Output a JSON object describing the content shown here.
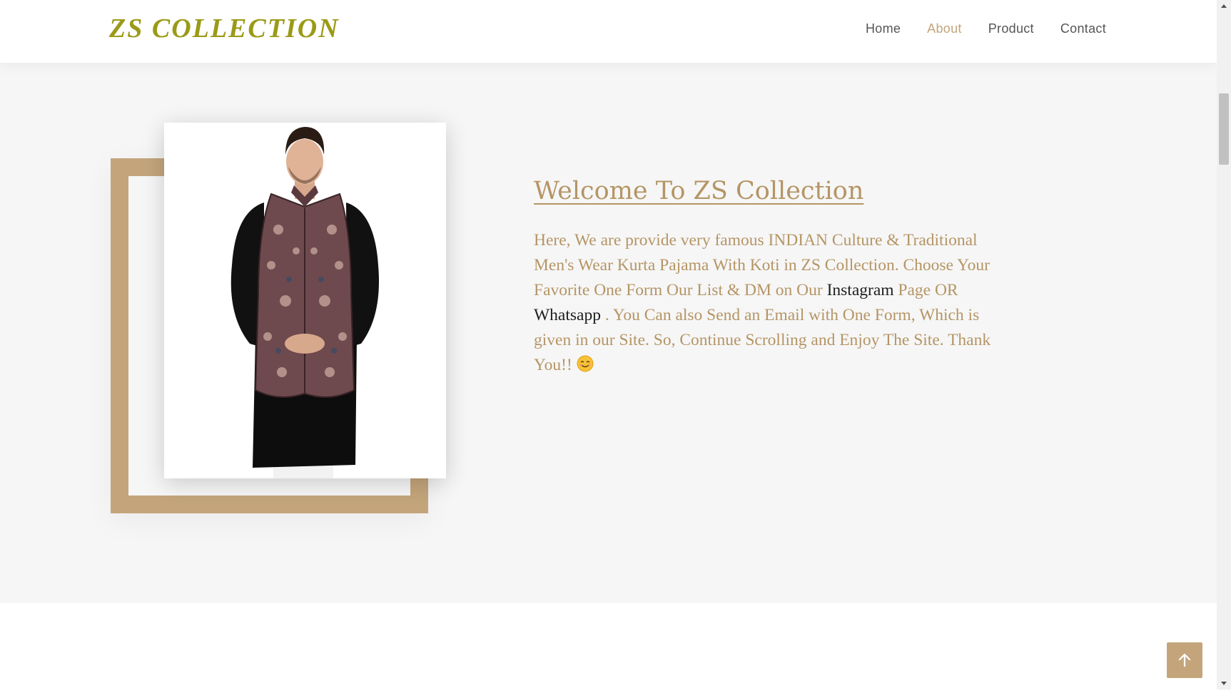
{
  "header": {
    "brand": "ZS COLLECTION",
    "nav": [
      {
        "label": "Home",
        "active": false
      },
      {
        "label": "About",
        "active": true
      },
      {
        "label": "Product",
        "active": false
      },
      {
        "label": "Contact",
        "active": false
      }
    ]
  },
  "about": {
    "title": "Welcome To ZS Collection",
    "text_1": "Here, We are provide very famous INDIAN Culture & Traditional Men's Wear Kurta Pajama With Koti in ZS Collection. Choose Your Favorite One Form Our List & DM on Our ",
    "instagram_link": "Instagram",
    "text_2": " Page OR ",
    "whatsapp_link": "Whatsapp",
    "text_3": " . You Can also Send an Email with One Form, Which is given in our Site. So, Continue Scrolling and Enjoy The Site. Thank You!!",
    "emoji": "smiling-wink-emoji"
  },
  "icons": {
    "scroll_top": "arrow-up-icon",
    "scroll_up": "triangle-up-icon",
    "scroll_down": "triangle-down-icon"
  },
  "colors": {
    "accent": "#c4a57b",
    "text_gold": "#b59565",
    "brand": "#9a9a18",
    "section_bg": "#f6f6f6",
    "nav_text": "#555555"
  }
}
